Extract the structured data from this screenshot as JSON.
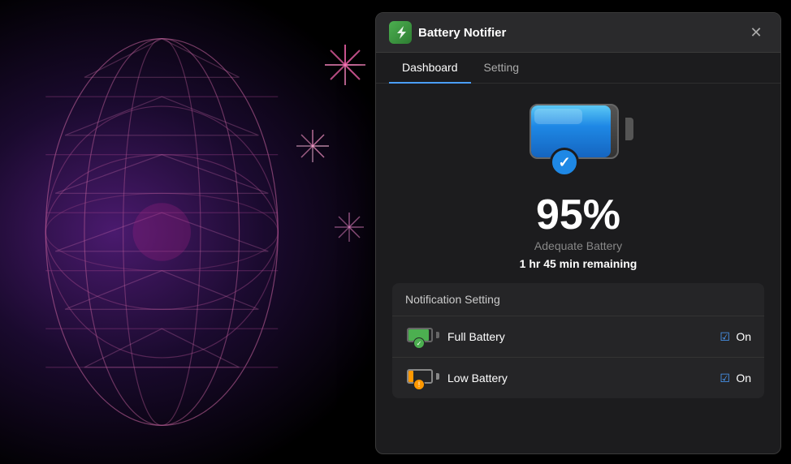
{
  "app": {
    "title": "Battery Notifier",
    "icon": "⚡",
    "close_label": "✕"
  },
  "tabs": [
    {
      "id": "dashboard",
      "label": "Dashboard",
      "active": true
    },
    {
      "id": "setting",
      "label": "Setting",
      "active": false
    }
  ],
  "dashboard": {
    "battery_percent": "95%",
    "battery_status": "Adequate Battery",
    "battery_time": "1 hr 45 min remaining"
  },
  "notification_section": {
    "header": "Notification Setting",
    "rows": [
      {
        "id": "full-battery",
        "label": "Full Battery",
        "toggle_label": "On",
        "enabled": true
      },
      {
        "id": "low-battery",
        "label": "Low Battery",
        "toggle_label": "On",
        "enabled": true
      }
    ]
  },
  "colors": {
    "accent": "#4a9eff",
    "green": "#4caf50",
    "orange": "#ff9800",
    "panel_bg": "#1c1c1e",
    "row_bg": "#252527"
  }
}
